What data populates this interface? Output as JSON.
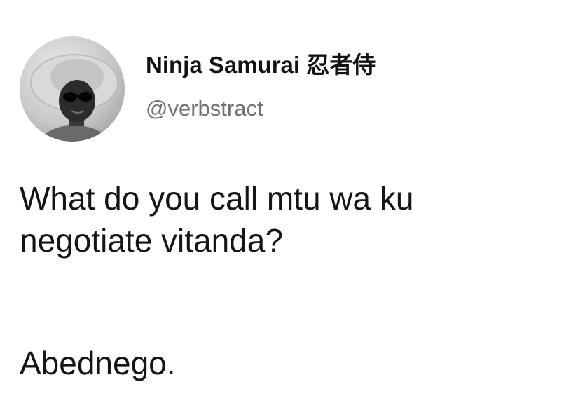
{
  "tweet": {
    "author": {
      "display_name": "Ninja Samurai 忍者侍",
      "handle": "@verbstract",
      "avatar_icon": "user-photo-avatar"
    },
    "text_line_1": "What do you call mtu wa ku",
    "text_line_2": "negotiate vitanda?",
    "punchline": "Abednego."
  }
}
